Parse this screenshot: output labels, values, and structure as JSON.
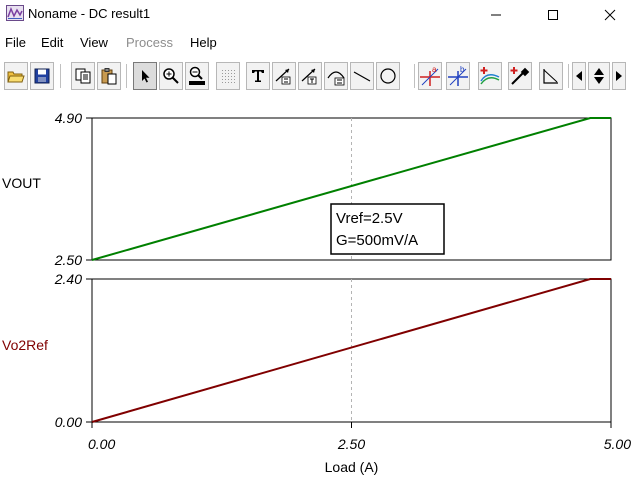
{
  "window": {
    "title": "Noname - DC result1",
    "minimize_glyph": "—",
    "maximize_glyph": "☐",
    "close_glyph": "✕"
  },
  "menu": {
    "items": [
      {
        "label": "File",
        "enabled": true
      },
      {
        "label": "Edit",
        "enabled": true
      },
      {
        "label": "View",
        "enabled": true
      },
      {
        "label": "Process",
        "enabled": false
      },
      {
        "label": "Help",
        "enabled": true
      }
    ]
  },
  "toolbar": {
    "buttons": [
      "open-icon",
      "save-icon",
      "copy-icon",
      "paste-icon",
      "select-arrow-icon",
      "zoom-in-icon",
      "zoom-100-icon",
      "grid-icon",
      "text-icon",
      "cursor-a-icon",
      "cursor-b-icon",
      "marker-icon",
      "line-icon",
      "circle-icon",
      "cursor-a-cross-icon",
      "cursor-b-cross-icon",
      "curve-add-icon",
      "color-picker-icon",
      "slope-icon"
    ],
    "scroll_left": "◂",
    "scroll_right": "▸",
    "spin_up": "▲",
    "spin_down": "▼"
  },
  "colors": {
    "vout_trace": "#008000",
    "vo2ref_trace": "#800000",
    "vo2ref_label": "#800000",
    "frame": "#000000",
    "grid": "#b4b4b4"
  },
  "chart_data": [
    {
      "type": "line",
      "ylabel": "VOUT",
      "ylim": [
        2.5,
        4.9
      ],
      "ytick_labels": [
        "4.90",
        "2.50"
      ],
      "xlim": [
        0,
        5
      ],
      "grid": "vertical dashed at x = 2.50",
      "series": [
        {
          "x": [
            0,
            4.8,
            5.0
          ],
          "y": [
            2.5,
            4.9,
            4.9
          ]
        }
      ],
      "annotation": [
        "Vref=2.5V",
        "G=500mV/A"
      ]
    },
    {
      "type": "line",
      "ylabel": "Vo2Ref",
      "ylim": [
        0,
        2.4
      ],
      "ytick_labels": [
        "2.40",
        "0.00"
      ],
      "xlim": [
        0,
        5
      ],
      "xlabel": "Load (A)",
      "xtick_labels": [
        "0.00",
        "2.50",
        "5.00"
      ],
      "grid": "vertical dashed at x = 2.50",
      "series": [
        {
          "x": [
            0,
            4.8,
            5.0
          ],
          "y": [
            0,
            2.4,
            2.4
          ]
        }
      ]
    }
  ]
}
